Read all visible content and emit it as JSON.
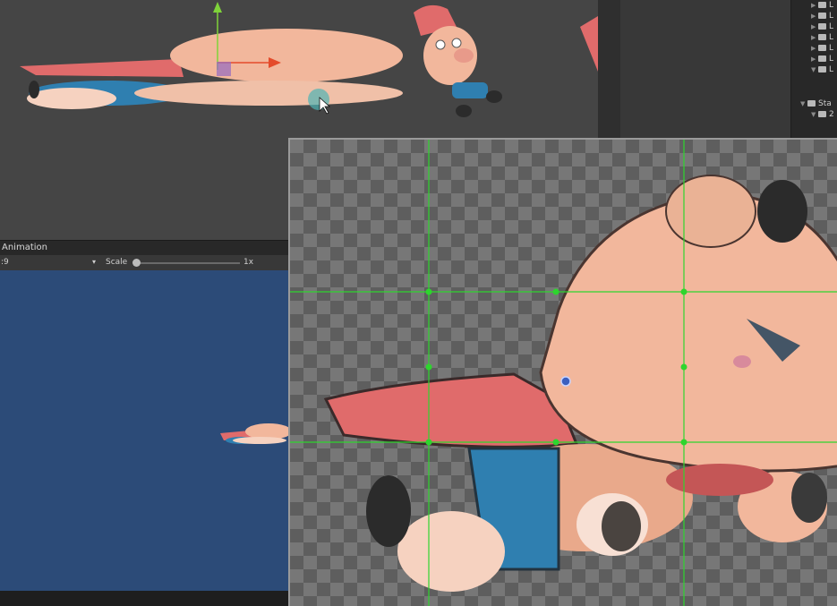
{
  "game_panel": {
    "tab_label": "Animation",
    "aspect_value": ":9",
    "aspect_chevron": "▾",
    "scale_label": "Scale",
    "scale_value": "1x",
    "scale_level": 0.0
  },
  "hierarchy": {
    "rows": [
      {
        "indent": 1,
        "arrow": "▶",
        "label": "L"
      },
      {
        "indent": 1,
        "arrow": "▶",
        "label": "L"
      },
      {
        "indent": 1,
        "arrow": "▶",
        "label": "L"
      },
      {
        "indent": 1,
        "arrow": "▶",
        "label": "L"
      },
      {
        "indent": 1,
        "arrow": "▶",
        "label": "L"
      },
      {
        "indent": 1,
        "arrow": "▶",
        "label": "L"
      },
      {
        "indent": 1,
        "arrow": "▼",
        "label": "L"
      },
      {
        "indent": 0,
        "arrow": "▼",
        "label": "Sta"
      },
      {
        "indent": 1,
        "arrow": "▼",
        "label": "2"
      }
    ]
  },
  "colors": {
    "scene_bg": "#454545",
    "game_bg": "#2c4b78",
    "grid_line": "#2ed52e",
    "pig_skin": "#f2b79c",
    "cape": "#e06b6b",
    "shorts": "#2f7fb0"
  }
}
